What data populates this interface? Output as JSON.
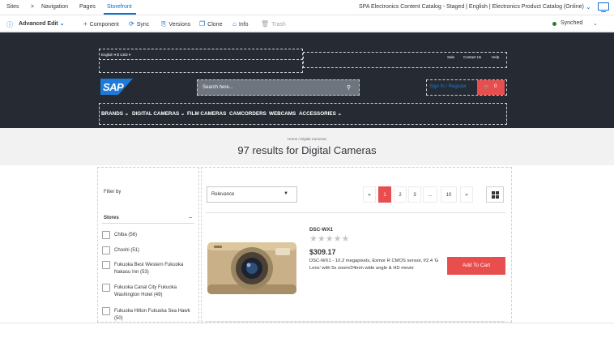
{
  "shell": {
    "sites": "Sites",
    "sites_sep": ">",
    "navigation": "Navigation",
    "pages": "Pages",
    "storefront": "Storefront",
    "catalog_label": "SPA Electronics Content Catalog - Staged | English | Electronics Product Catalog (Online)"
  },
  "toolbar": {
    "mode": "Advanced Edit",
    "component": "Component",
    "sync": "Sync",
    "versions": "Versions",
    "clone": "Clone",
    "info": "Info",
    "trash": "Trash",
    "status": "Synched"
  },
  "storefront": {
    "lang_currency": "English ▾  $ USD ▾",
    "sale": "Sale",
    "contact": "Contact Us",
    "help": "Help",
    "logo": "SAP",
    "search_placeholder": "Search here...",
    "signin": "Sign In / Register",
    "cart_count": "0",
    "nav": [
      "BRANDS ⌄",
      "DIGITAL CAMERAS ⌄",
      "FILM CAMERAS",
      "CAMCORDERS",
      "WEBCAMS",
      "ACCESSORIES ⌄"
    ]
  },
  "results": {
    "breadcrumb": "Home / Digital Cameras",
    "title": "97 results for Digital Cameras"
  },
  "filters": {
    "filter_by": "Filter by",
    "stores_label": "Stores",
    "collapse": "–",
    "stores": [
      "Chiba (56)",
      "Choshi (51)",
      "Fukuoka Best Western Fukuoka Nakasu Inn (53)",
      "Fukuoka Canal City Fukuoka Washington Hotel (49)",
      "Fukuoka Hilton Fukuoka Sea Hawk (50)"
    ]
  },
  "listing": {
    "sort": "Relevance",
    "pages": [
      "«",
      "1",
      "2",
      "3",
      "...",
      "10",
      "»"
    ],
    "active_page": "1",
    "product": {
      "name": "DSC-WX1",
      "rating": 0,
      "price": "$309.17",
      "description": "DSC-WX1 - 10.2 megapixels, Exmor R CMOS sensor, f/2.4 'G Lens' with 5x zoom/24mm wide angle & HD movie",
      "add_to_cart": "Add To Cart"
    }
  },
  "colors": {
    "accent": "#0a6ed1",
    "header_bg": "#252a33",
    "brand_red": "#e84e4e",
    "synched": "#2b7d2b"
  }
}
